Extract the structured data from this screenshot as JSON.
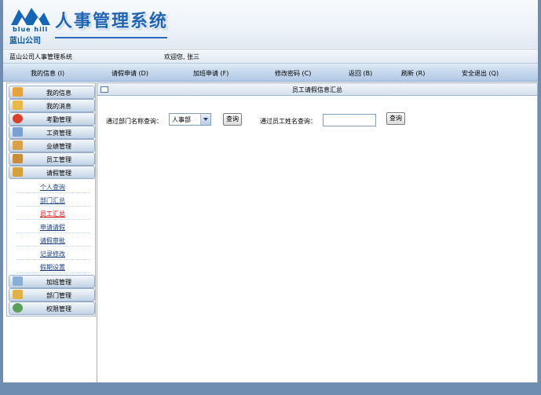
{
  "header": {
    "logo_en": "blue hill",
    "logo_cn": "蓝山公司",
    "system_title": "人事管理系统"
  },
  "infobar": {
    "company_system": "蓝山公司人事管理系统",
    "welcome": "欢迎您, 张三"
  },
  "menu": {
    "items": [
      {
        "label": "我的信息 (I)"
      },
      {
        "label": "请假申请 (D)"
      },
      {
        "label": "加班申请 (F)"
      },
      {
        "label": "修改密码 (C)"
      },
      {
        "label": "返回 (B)"
      },
      {
        "label": "刷新 (R)"
      },
      {
        "label": "安全退出 (Q)"
      }
    ]
  },
  "sidebar": {
    "groups_top": [
      {
        "label": "我的信息",
        "icon": "user-edit-icon",
        "color": "#e6a23c"
      },
      {
        "label": "我的消息",
        "icon": "message-icon",
        "color": "#e8b84a"
      },
      {
        "label": "考勤管理",
        "icon": "clock-icon",
        "color": "#d9412e"
      },
      {
        "label": "工资管理",
        "icon": "document-money-icon",
        "color": "#7aa0d4"
      },
      {
        "label": "业绩管理",
        "icon": "box-icon",
        "color": "#d8a24a"
      },
      {
        "label": "员工管理",
        "icon": "people-icon",
        "color": "#c98c3a"
      },
      {
        "label": "请假管理",
        "icon": "leave-icon",
        "color": "#d6a13c"
      }
    ],
    "sub_items": [
      {
        "label": "个人查询"
      },
      {
        "label": "部门汇总"
      },
      {
        "label": "员工汇总"
      },
      {
        "label": "申请请假"
      },
      {
        "label": "请假审批"
      },
      {
        "label": "记录修改"
      },
      {
        "label": "假期设置"
      }
    ],
    "groups_bottom": [
      {
        "label": "加班管理",
        "icon": "pencil-icon",
        "color": "#8ab0d8"
      },
      {
        "label": "部门管理",
        "icon": "folder-icon",
        "color": "#e0b24a"
      },
      {
        "label": "权限管理",
        "icon": "globe-icon",
        "color": "#5aa05a"
      }
    ]
  },
  "main": {
    "title": "员工请假信息汇总",
    "dept_query_label": "通过部门名称查询：",
    "dept_selected": "人事部",
    "query_button": "查询",
    "name_query_label": "通过员工姓名查询：",
    "name_value": ""
  }
}
